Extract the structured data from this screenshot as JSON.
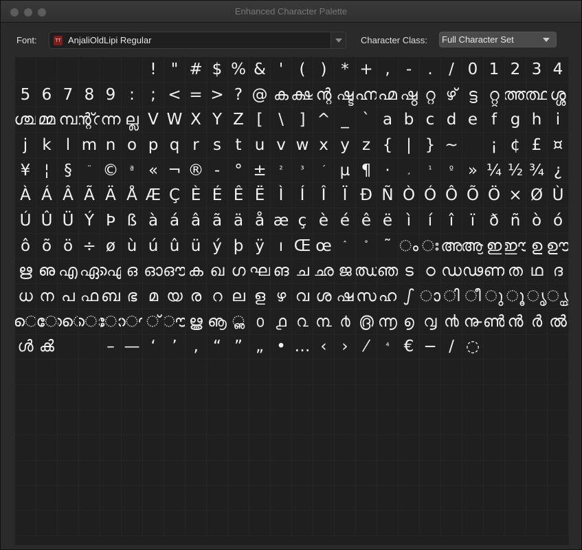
{
  "window": {
    "title": "Enhanced Character Palette"
  },
  "toolbar": {
    "font_label": "Font:",
    "font_value": "AnjaliOldLipi Regular",
    "font_icon_text": "TT",
    "class_label": "Character Class:",
    "class_value": "Full Character Set"
  },
  "glyphs": [
    " ",
    " ",
    " ",
    " ",
    " ",
    " ",
    "!",
    "\"",
    "#",
    "$",
    "%",
    "&",
    "'",
    "(",
    ")",
    "*",
    "+",
    ",",
    "-",
    ".",
    "/",
    "0",
    "1",
    "2",
    "3",
    "4",
    "5",
    "6",
    "7",
    "8",
    "9",
    ":",
    ";",
    "<",
    "=",
    ">",
    "?",
    "@",
    "ക",
    "ക്ഷ",
    "ന്റ",
    "ഷ്ട",
    "ഹ്ന",
    "ഹ്മ",
    "ഷ്ഠ",
    "റ്റ",
    "ഴ്",
    "ട്ട",
    "റ്റ്റ",
    "ത്ത",
    "ത്ഥ",
    "ശ്ശ",
    "ശ്ച",
    "മ്മ",
    "മ്പ",
    "ന്റ്റ",
    "ന്ന",
    "ല്ല",
    "V",
    "W",
    "X",
    "Y",
    "Z",
    "[",
    "\\",
    "]",
    "^",
    "_",
    "`",
    "a",
    "b",
    "c",
    "d",
    "e",
    "f",
    "g",
    "h",
    "i",
    "j",
    "k",
    "l",
    "m",
    "n",
    "o",
    "p",
    "q",
    "r",
    "s",
    "t",
    "u",
    "v",
    "w",
    "x",
    "y",
    "z",
    "{",
    "|",
    "}",
    "~",
    " ",
    "¡",
    "¢",
    "£",
    "¤",
    "¥",
    "¦",
    "§",
    "¨",
    "©",
    "ª",
    "«",
    "¬",
    "®",
    "-",
    "°",
    "±",
    "²",
    "³",
    "´",
    "µ",
    "¶",
    "·",
    "¸",
    "¹",
    "º",
    "»",
    "¼",
    "½",
    "¾",
    "¿",
    "À",
    "Á",
    "Â",
    "Ã",
    "Ä",
    "Å",
    "Æ",
    "Ç",
    "È",
    "É",
    "Ê",
    "Ë",
    "Ì",
    "Í",
    "Î",
    "Ï",
    "Ð",
    "Ñ",
    "Ò",
    "Ó",
    "Ô",
    "Õ",
    "Ö",
    "×",
    "Ø",
    "Ù",
    "Ú",
    "Û",
    "Ü",
    "Ý",
    "Þ",
    "ß",
    "à",
    "á",
    "â",
    "ã",
    "ä",
    "å",
    "æ",
    "ç",
    "è",
    "é",
    "ê",
    "ë",
    "ì",
    "í",
    "î",
    "ï",
    "ð",
    "ñ",
    "ò",
    "ó",
    "ô",
    "õ",
    "ö",
    "÷",
    "ø",
    "ù",
    "ú",
    "û",
    "ü",
    "ý",
    "þ",
    "ÿ",
    "ı",
    "Œ",
    "œ",
    "ˆ",
    "˚",
    "˜",
    "ം",
    "ഃ",
    "അ",
    "ആ",
    "ഇ",
    "ഈ",
    "ഉ",
    "ഊ",
    "ഋ",
    "ഌ",
    "എ",
    "ഏ",
    "ഐ",
    "ഒ",
    "ഓ",
    "ഔ",
    "ക",
    "ഖ",
    "ഗ",
    "ഘ",
    "ങ",
    "ച",
    "ഛ",
    "ജ",
    "ഝ",
    "ഞ",
    "ട",
    "ഠ",
    "ഡ",
    "ഢ",
    "ണ",
    "ത",
    "ഥ",
    "ദ",
    "ധ",
    "ന",
    "പ",
    "ഫ",
    "ബ",
    "ഭ",
    "മ",
    "യ",
    "ര",
    "റ",
    "ല",
    "ള",
    "ഴ",
    "വ",
    "ശ",
    "ഷ",
    "സ",
    "ഹ",
    "ഽ",
    "ാ",
    "ി",
    "ീ",
    "ു",
    "ൂ",
    "ൃ",
    "ൄ",
    "െ",
    "േ",
    "ൈ",
    "ൊ",
    "ോ",
    "ൌ",
    "്",
    "ൗ",
    "ൠ",
    "ൡ",
    "ൢ",
    "൦",
    "൧",
    "൨",
    "൩",
    "൪",
    "൫",
    "൬",
    "൭",
    "൮",
    "൯",
    "൹",
    "ൺ",
    "ൻ",
    "ർ",
    "ൽ",
    "ൾ",
    "ൿ",
    "‌",
    "‍",
    "–",
    "—",
    "‘",
    "’",
    "‚",
    "“",
    "”",
    "„",
    "•",
    "…",
    "‹",
    "›",
    "⁄",
    "⁴",
    "€",
    "−",
    "∕",
    "◌"
  ]
}
